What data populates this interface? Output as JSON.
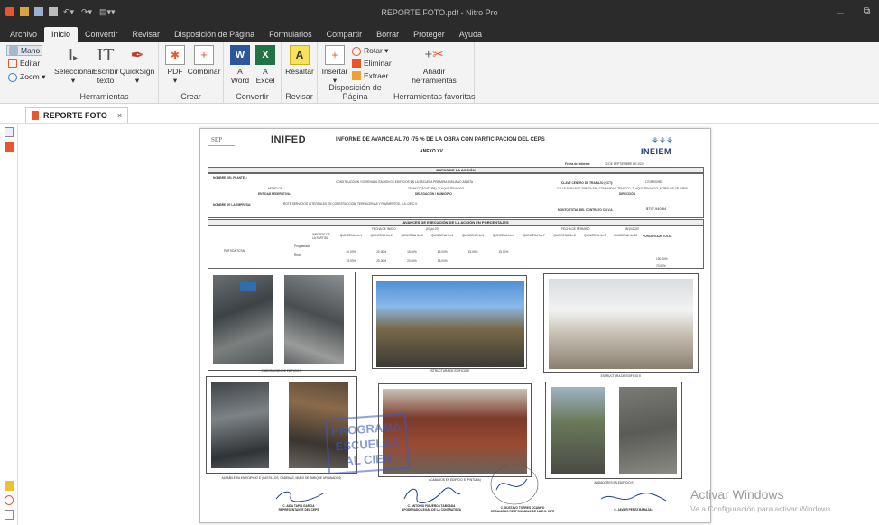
{
  "window": {
    "title": "REPORTE FOTO.pdf - Nitro Pro"
  },
  "menu": {
    "tabs": [
      "Archivo",
      "Inicio",
      "Convertir",
      "Revisar",
      "Disposición de Página",
      "Formularios",
      "Compartir",
      "Borrar",
      "Proteger",
      "Ayuda"
    ],
    "active": "Inicio"
  },
  "ribbon": {
    "mano": "Mano",
    "editar": "Editar",
    "zoom": "Zoom ▾",
    "seleccionar": "Seleccionar",
    "escribir1": "Escribir",
    "escribir2": "texto",
    "quicksign": "QuickSign",
    "grp_herramientas": "Herramientas",
    "pdf": "PDF",
    "combinar": "Combinar",
    "grp_crear": "Crear",
    "a_word1": "A",
    "a_word2": "Word",
    "a_excel1": "A",
    "a_excel2": "Excel",
    "grp_convertir": "Convertir",
    "resaltar": "Resaltar",
    "grp_revisar": "Revisar",
    "insertar": "Insertar",
    "rotar": "Rotar ▾",
    "eliminar": "Eliminar",
    "extraer": "Extraer",
    "grp_disposicion": "Disposición de Página",
    "anadir1": "Añadir",
    "anadir2": "herramientas",
    "grp_favoritas": "Herramientas favoritas"
  },
  "document_tab": {
    "label": "REPORTE FOTO",
    "close": "×"
  },
  "document": {
    "sep": "SEP",
    "inifed": "INIFED",
    "heading": "INFORME DE AVANCE AL 70 -75 % DE LA OBRA CON PARTICIPACION DEL CEPS",
    "anexo": "ANEXO XV",
    "ineiem": "INEIEM",
    "fecha_label": "Fecha del Informe:",
    "fecha_value": "30 DE SEPTIEMBRE DE 2020",
    "datos_accion": "DATOS DE LA ACCIÓN",
    "nombre_plantel": "NOMBRE DEL PLANTEL:",
    "plantel_value": "CONSTRUCCION Y/O REHABILITACION DE EDIFICIOS EN LA ESCUELA PRIMARIA EMILIANO ZAPATA",
    "clave_label": "CLAVE CENTRO DE TRABAJO (CCT):",
    "clave_value": "17DPR0095X",
    "entidad": "MORELOS",
    "entidad_label": "ENTIDAD FEDERATIVA:",
    "municipio": "TEMIXCO(ACATLIPA), TLAQUILTENANGO",
    "municipio_label": "DELEGACIÓN / MUNICIPIO",
    "direccion": "CALLE EMILIANO ZAPATA S/N, COMUNIDAD TEMIXCO, TLAQUILTENANGO, MORELOS CP 62800",
    "direccion_label": "DIRECCIÓN",
    "empresa_label": "NOMBRE DE LA EMPRESA:",
    "empresa_value": "ROTE SERVICIOS INTEGRALES EN CONSTRUCCION, TERRACERIAS Y PAVIMENTOS, S.A. DE C.V.",
    "monto_label": "MONTO TOTAL DEL CONTRATO C/ I.V.A.",
    "monto_value": "$797,940.84",
    "avances": "AVANCES DE EJECUCIÓN DE LA ACCIÓN EN PORCENTAJES",
    "fecha_inicio": "FECHA DE INICIO",
    "fecha_inicio_val": "(03-jul-20)",
    "fecha_termino": "FECHA DE TÉRMINO",
    "fecha_termino_val": "28/10/2020",
    "importe": "IMPORTE DE LA PARTIDA",
    "semanas": [
      "QUINCENA No.1",
      "QUINCENA No.2",
      "QUINCENA No.3",
      "QUINCENA No.4",
      "QUINCENA No.5",
      "QUINCENA No.6",
      "QUINCENA No.7",
      "QUINCENA No.8",
      "QUINCENA No.9",
      "QUINCENA No.10"
    ],
    "pct_total": "PORCENTAJE TOTAL",
    "partida": "PARTIDA TOTAL",
    "programado": "Programado",
    "real": "Real",
    "prog_values": [
      "20.00%",
      "20.00%",
      "15.00%",
      "15.00%",
      "15.00%",
      "15.00%"
    ],
    "real_values": [
      "15.00%",
      "20.00%",
      "20.00%",
      "15.00%"
    ],
    "total_prog": "100.00%",
    "total_real": "70.00%",
    "captions": [
      "CIMENTACION DE EDIFICIO E",
      "ESTRUCTURA DE EDIFICIO E",
      "ESTRUCTURA DE EDIFICIO E",
      "ALBAÑILERIA EN EDIFICIO E (CASTILLOS, CADENAS, MURO DE TABIQUE APLANADOS)",
      "ACABADOS EN EDIFICIO E (PINTURA)",
      "ANDADORES EN EDIFICIO E"
    ],
    "stamp": "PROGRAMA ESCUELAS AL CIEN",
    "sig1_name": "C. AIDA TAPIA GARCIA",
    "sig1_role": "REPRESENTANTE DEL CEPS",
    "sig2_name": "C. ANTONIO FIGUEROA TABOADA",
    "sig2_role": "APODERADO LEGAL DE LA CONTRATISTA",
    "sig3_name": "C. GUSTAVO TORRES OCAMPO",
    "sig3_role": "ORGANISMO RESPONSABLE DE LA E.S. INFR",
    "sig4_name": "C. JAVIER PEREZ BARAJAS"
  },
  "watermark": {
    "line1": "Activar Windows",
    "line2": "Ve a Configuración para activar Windows."
  }
}
